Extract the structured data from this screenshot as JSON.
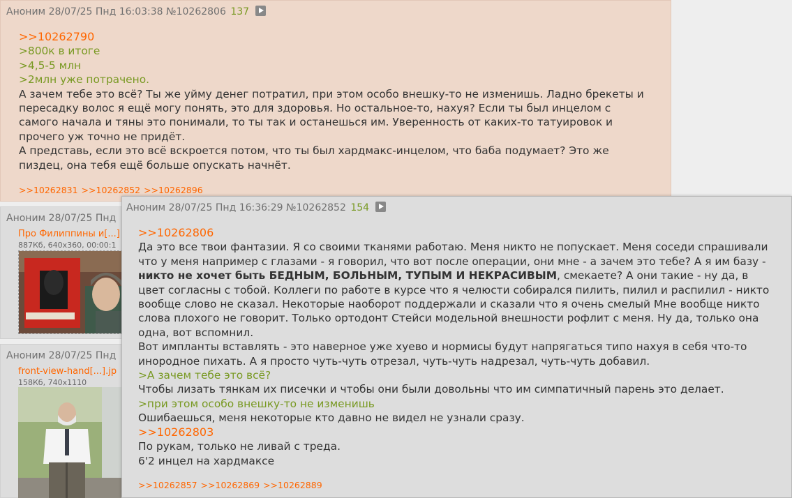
{
  "post1": {
    "header": {
      "name": "Аноним",
      "date": "28/07/25 Пнд 16:03:38",
      "num": "№10262806",
      "count": "137"
    },
    "lines": [
      {
        "text": ">>10262790",
        "kind": "link"
      },
      {
        "text": ">800к в итоге",
        "kind": "quote"
      },
      {
        "text": ">4,5-5 млн",
        "kind": "quote"
      },
      {
        "text": ">2млн уже потрачено.",
        "kind": "quote"
      },
      {
        "text": "А зачем тебе это всё? Ты же уйму денег потратил, при этом особо внешку-то не изменишь. Ладно брекеты и",
        "kind": "text"
      },
      {
        "text": "пересадку волос я ещё могу понять, это для здоровья. Но остальное-то, нахуя? Если ты был инцелом с",
        "kind": "text"
      },
      {
        "text": "самого начала и тяны это понимали, то ты так и останешься им. Уверенность от каких-то татуировок и",
        "kind": "text"
      },
      {
        "text": "прочего уж точно не придёт.",
        "kind": "text"
      },
      {
        "text": "А представь, если это всё вскроется потом, что ты был хардмакс-инцелом, что баба подумает? Это же",
        "kind": "text"
      },
      {
        "text": "пиздец, она тебя ещё больше опускать начнёт.",
        "kind": "text"
      }
    ],
    "replies": ">>10262831 >>10262852 >>10262896"
  },
  "post2": {
    "header": {
      "name": "Аноним",
      "date": "28/07/25 Пнд"
    },
    "file_name": "Про Филиппины и[...]",
    "file_meta": "887Кб, 640x360, 00:00:1"
  },
  "post3": {
    "header": {
      "name": "Аноним",
      "date": "28/07/25 Пнд"
    },
    "file_name": "front-view-hand[...].jp",
    "file_meta": "158Кб, 740x1110"
  },
  "post4": {
    "header": {
      "name": "Аноним",
      "date": "28/07/25 Пнд 16:36:29",
      "num": "№10262852",
      "count": "154"
    },
    "link1": ">>10262806",
    "l1": "Да это все твои фантазии. Я со своими тканями работаю. Меня никто не попускает. Меня соседи спрашивали",
    "l2": "что у меня например с глазами - я говорил, что вот после операции, они мне - а зачем это тебе? А я им базу -",
    "l3_bold": "никто не хочет быть БЕДНЫМ, БОЛЬНЫМ, ТУПЫМ И НЕКРАСИВЫМ",
    "l3_rest": ", смекаете? А они такие - ну да, в",
    "l4": "цвет согласны с тобой. Коллеги по работе в курсе что я челюсти собирался пилить, пилил и распилил - никто",
    "l5": "вообще слово не сказал. Некоторые наоборот поддержали и сказали что я очень смелый Мне вообще никто",
    "l6": "слова плохого не говорит. Только ортодонт Стейси модельной внешности рофлит с меня. Ну да, только она",
    "l7": "одна, вот вспомнил.",
    "l8": "Вот импланты вставлять - это наверное уже хуево и нормисы будут напрягаться типо нахуя в себя что-то",
    "l9": "инородное пихать. А я просто чуть-чуть отрезал, чуть-чуть надрезал, чуть-чуть добавил.",
    "q1": ">А зачем тебе это всё?",
    "l10": "Чтобы лизать тянкам их писечки и чтобы они были довольны что им симпатичный парень это делает.",
    "q2": ">при этом особо внешку-то не изменишь",
    "l11": "Ошибаешься, меня некоторые кто давно не видел не узнали сразу.",
    "link2": ">>10262803",
    "l12": "По рукам, только не ливай с треда.",
    "l13": "6'2 инцел на хардмаксе",
    "replies": ">>10262857 >>10262869 >>10262889"
  }
}
